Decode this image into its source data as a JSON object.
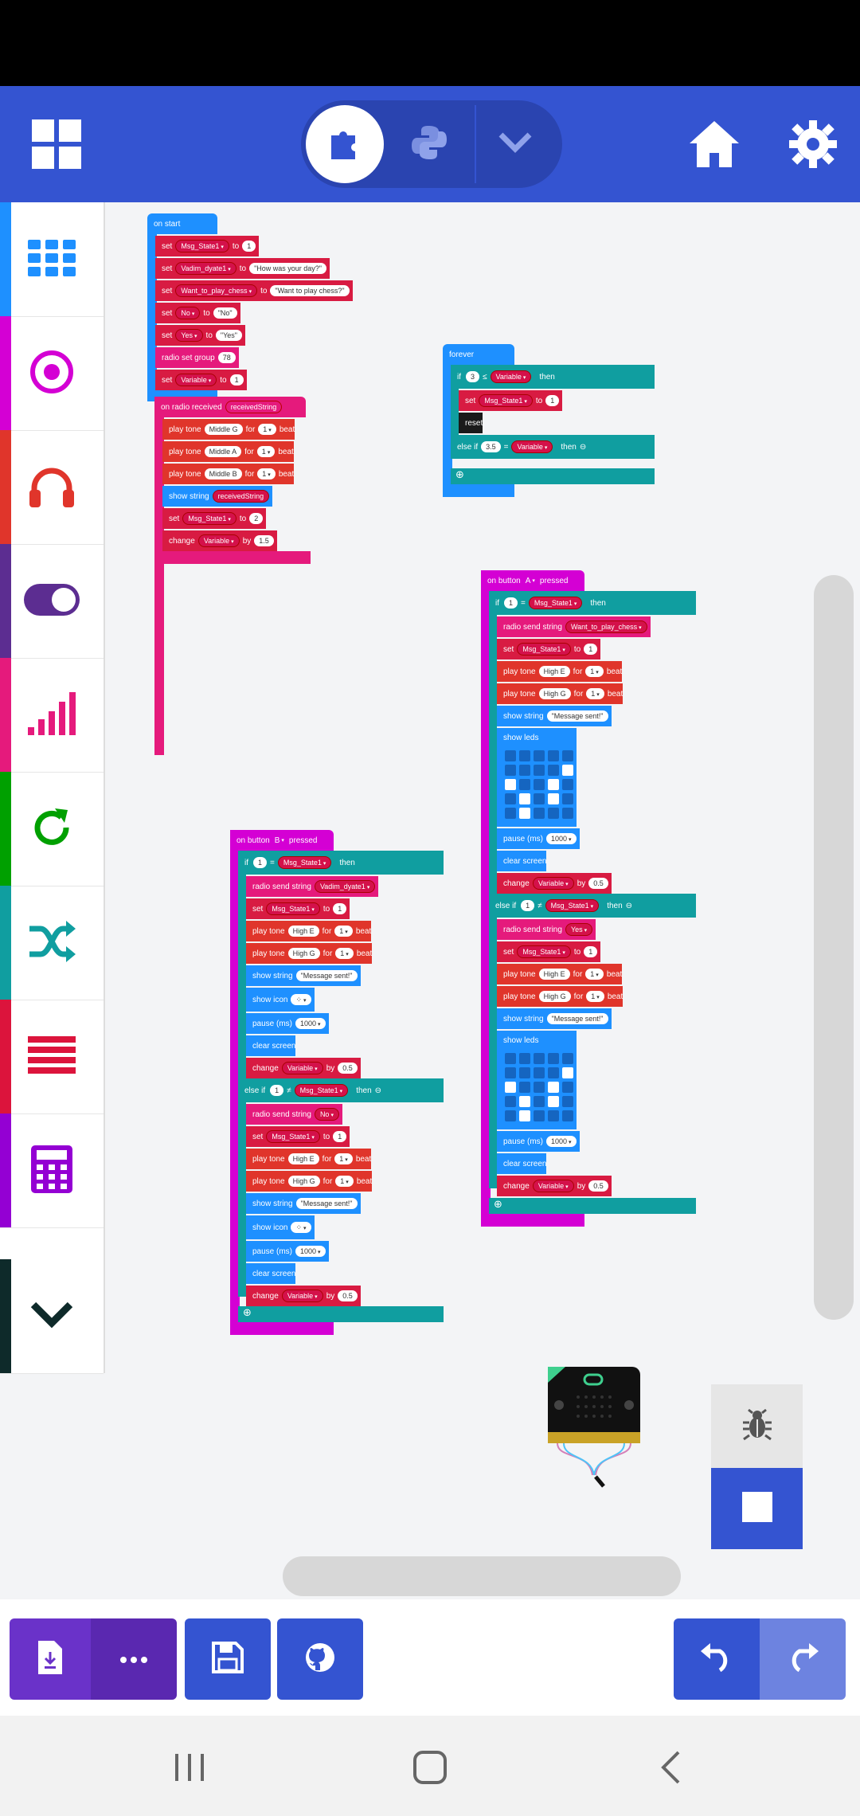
{
  "header": {
    "editor_icon": "grid-icon",
    "mode_blocks_icon": "puzzle-icon",
    "mode_python_icon": "python-icon",
    "mode_more_icon": "chevron-down-icon",
    "home_icon": "home-icon",
    "settings_icon": "gear-icon",
    "accent": "#3454d1"
  },
  "toolbox": {
    "items": [
      {
        "name": "basic",
        "icon": "grid-icon",
        "color": "#1e90ff"
      },
      {
        "name": "input",
        "icon": "target-icon",
        "color": "#d400d4"
      },
      {
        "name": "music",
        "icon": "headphones-icon",
        "color": "#e0352b"
      },
      {
        "name": "led",
        "icon": "toggle-icon",
        "color": "#5c2d91"
      },
      {
        "name": "radio",
        "icon": "signal-icon",
        "color": "#e51a7c"
      },
      {
        "name": "loops",
        "icon": "refresh-icon",
        "color": "#00a000"
      },
      {
        "name": "logic",
        "icon": "shuffle-icon",
        "color": "#109ea0"
      },
      {
        "name": "variables",
        "icon": "lines-icon",
        "color": "#dc143c"
      },
      {
        "name": "math",
        "icon": "calculator-icon",
        "color": "#9400d3"
      },
      {
        "name": "more",
        "icon": "chevron-down-icon",
        "color": "#0e2a2a"
      }
    ]
  },
  "blocks": {
    "on_start": {
      "hat": "on start",
      "set1": {
        "kw": "set",
        "var": "Msg_State1",
        "to": "to",
        "val": "1"
      },
      "set2": {
        "kw": "set",
        "var": "Vadim_dyate1",
        "to": "to",
        "val": "\"How was your day?\""
      },
      "set3": {
        "kw": "set",
        "var": "Want_to_play_chess",
        "to": "to",
        "val": "\"Want to play chess?\""
      },
      "set4": {
        "kw": "set",
        "var": "No",
        "to": "to",
        "val": "\"No\""
      },
      "set5": {
        "kw": "set",
        "var": "Yes",
        "to": "to",
        "val": "\"Yes\""
      },
      "radio": {
        "kw": "radio set group",
        "val": "78"
      },
      "set6": {
        "kw": "set",
        "var": "Variable",
        "to": "to",
        "val": "1"
      }
    },
    "on_radio": {
      "hat": "on radio received",
      "param": "receivedString",
      "tone1": {
        "kw": "play tone",
        "note": "Middle G",
        "for": "for",
        "beat": "1",
        "unit": "beat"
      },
      "tone2": {
        "kw": "play tone",
        "note": "Middle A",
        "for": "for",
        "beat": "1",
        "unit": "beat"
      },
      "tone3": {
        "kw": "play tone",
        "note": "Middle B",
        "for": "for",
        "beat": "1",
        "unit": "beat"
      },
      "show": {
        "kw": "show string",
        "val": "receivedString"
      },
      "set": {
        "kw": "set",
        "var": "Msg_State1",
        "to": "to",
        "val": "2"
      },
      "change": {
        "kw": "change",
        "var": "Variable",
        "by": "by",
        "val": "1.5"
      }
    },
    "forever": {
      "hat": "forever",
      "if_kw": "if",
      "if_left": "3",
      "if_op": "≤",
      "if_right": "Variable",
      "then": "then",
      "set": {
        "kw": "set",
        "var": "Msg_State1",
        "to": "to",
        "val": "1"
      },
      "reset": "reset",
      "elseif_kw": "else if",
      "elseif_left": "3.5",
      "elseif_op": "=",
      "elseif_right": "Variable"
    },
    "button_a": {
      "hat": "on button",
      "btn": "A",
      "pressed": "pressed",
      "if_kw": "if",
      "if_left": "1",
      "if_op": "=",
      "if_right": "Msg_State1",
      "then": "then",
      "send1": {
        "kw": "radio send string",
        "val": "Want_to_play_chess"
      },
      "set1": {
        "kw": "set",
        "var": "Msg_State1",
        "to": "to",
        "val": "1"
      },
      "tone1": {
        "kw": "play tone",
        "note": "High E",
        "for": "for",
        "beat": "1",
        "unit": "beat"
      },
      "tone2": {
        "kw": "play tone",
        "note": "High G",
        "for": "for",
        "beat": "1",
        "unit": "beat"
      },
      "show1": {
        "kw": "show string",
        "val": "\"Message sent!\""
      },
      "leds1": "show leds",
      "pause1": {
        "kw": "pause (ms)",
        "val": "1000"
      },
      "clear1": "clear screen",
      "change1": {
        "kw": "change",
        "var": "Variable",
        "by": "by",
        "val": "0.5"
      },
      "elseif_kw": "else if",
      "elseif_left": "1",
      "elseif_op": "≠",
      "elseif_right": "Msg_State1",
      "send2": {
        "kw": "radio send string",
        "val": "Yes"
      },
      "set2": {
        "kw": "set",
        "var": "Msg_State1",
        "to": "to",
        "val": "1"
      },
      "tone3": {
        "kw": "play tone",
        "note": "High E",
        "for": "for",
        "beat": "1",
        "unit": "beat"
      },
      "tone4": {
        "kw": "play tone",
        "note": "High G",
        "for": "for",
        "beat": "1",
        "unit": "beat"
      },
      "show2": {
        "kw": "show string",
        "val": "\"Message sent!\""
      },
      "leds2": "show leds",
      "pause2": {
        "kw": "pause (ms)",
        "val": "1000"
      },
      "clear2": "clear screen",
      "change2": {
        "kw": "change",
        "var": "Variable",
        "by": "by",
        "val": "0.5"
      }
    },
    "button_b": {
      "hat": "on button",
      "btn": "B",
      "pressed": "pressed",
      "if_kw": "if",
      "if_left": "1",
      "if_op": "=",
      "if_right": "Msg_State1",
      "then": "then",
      "send1": {
        "kw": "radio send string",
        "val": "Vadim_dyate1"
      },
      "set1": {
        "kw": "set",
        "var": "Msg_State1",
        "to": "to",
        "val": "1"
      },
      "tone1": {
        "kw": "play tone",
        "note": "High E",
        "for": "for",
        "beat": "1",
        "unit": "beat"
      },
      "tone2": {
        "kw": "play tone",
        "note": "High G",
        "for": "for",
        "beat": "1",
        "unit": "beat"
      },
      "show1": {
        "kw": "show string",
        "val": "\"Message sent!\""
      },
      "icon1": "show icon",
      "pause1": {
        "kw": "pause (ms)",
        "val": "1000"
      },
      "clear1": "clear screen",
      "change1": {
        "kw": "change",
        "var": "Variable",
        "by": "by",
        "val": "0.5"
      },
      "elseif_kw": "else if",
      "elseif_left": "1",
      "elseif_op": "≠",
      "elseif_right": "Msg_State1",
      "send2": {
        "kw": "radio send string",
        "val": "No"
      },
      "set2": {
        "kw": "set",
        "var": "Msg_State1",
        "to": "to",
        "val": "1"
      },
      "tone3": {
        "kw": "play tone",
        "note": "High E",
        "for": "for",
        "beat": "1",
        "unit": "beat"
      },
      "tone4": {
        "kw": "play tone",
        "note": "High G",
        "for": "for",
        "beat": "1",
        "unit": "beat"
      },
      "show2": {
        "kw": "show string",
        "val": "\"Message sent!\""
      },
      "icon2": "show icon",
      "pause2": {
        "kw": "pause (ms)",
        "val": "1000"
      },
      "clear2": "clear screen",
      "change2": {
        "kw": "change",
        "var": "Variable",
        "by": "by",
        "val": "0.5"
      }
    }
  },
  "simulator": {
    "debug_icon": "bug-icon",
    "stop_icon": "stop-icon"
  },
  "bottombar": {
    "download_icon": "download-icon",
    "more_icon": "more-icon",
    "save_icon": "save-icon",
    "github_icon": "github-icon",
    "undo_icon": "undo-icon",
    "redo_icon": "redo-icon"
  },
  "navbar": {
    "recent_icon": "recent-apps-icon",
    "home_icon": "home-nav-icon",
    "back_icon": "back-icon"
  }
}
